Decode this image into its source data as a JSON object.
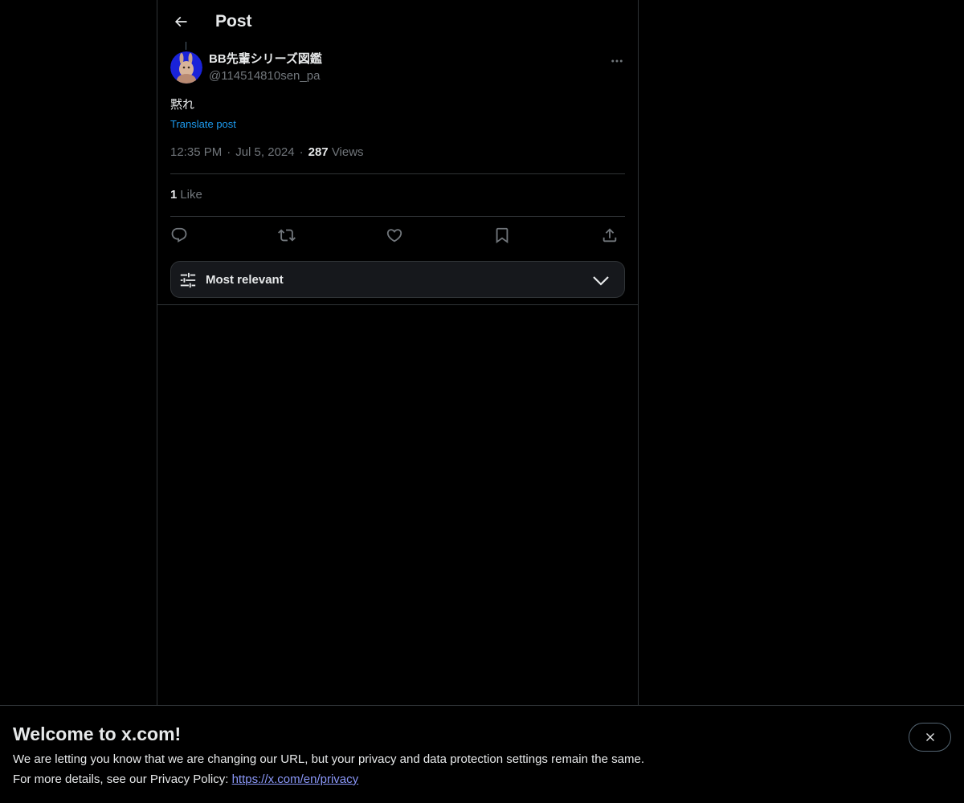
{
  "header": {
    "title": "Post"
  },
  "post": {
    "author_name": "BB先輩シリーズ図鑑",
    "author_handle": "@114514810sen_pa",
    "text": "黙れ",
    "translate_label": "Translate post",
    "time": "12:35 PM",
    "separator": "·",
    "date": "Jul 5, 2024",
    "views_count": "287",
    "views_label": "Views",
    "likes_count": "1",
    "likes_label": "Like"
  },
  "actions": {
    "icons": [
      "reply-icon",
      "repost-icon",
      "like-icon",
      "bookmark-icon",
      "share-icon"
    ]
  },
  "sort": {
    "label": "Most relevant"
  },
  "banner": {
    "title": "Welcome to x.com!",
    "line1": "We are letting you know that we are changing our URL, but your privacy and data protection settings remain the same.",
    "line2_prefix": "For more details, see our Privacy Policy: ",
    "link_text": "https://x.com/en/privacy"
  },
  "colors": {
    "background": "#000000",
    "text_primary": "#e7e9ea",
    "text_secondary": "#71767b",
    "accent": "#1d9bf0",
    "link": "#8b98f9",
    "border": "#2f3336"
  }
}
